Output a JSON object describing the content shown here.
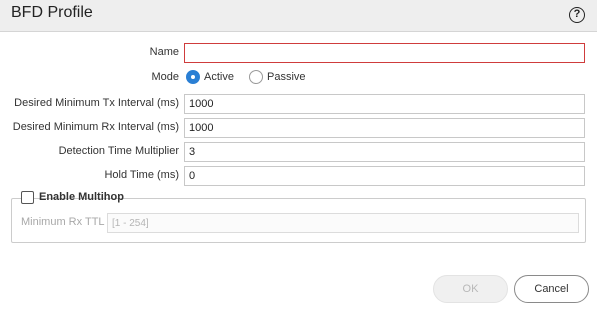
{
  "dialog": {
    "title": "BFD Profile",
    "help_symbol": "?"
  },
  "form": {
    "name": {
      "label": "Name",
      "value": "",
      "required": true
    },
    "mode": {
      "label": "Mode",
      "options": [
        {
          "label": "Active",
          "checked": true
        },
        {
          "label": "Passive",
          "checked": false
        }
      ]
    },
    "tx_interval": {
      "label": "Desired Minimum Tx Interval (ms)",
      "value": "1000"
    },
    "rx_interval": {
      "label": "Desired Minimum Rx Interval (ms)",
      "value": "1000"
    },
    "detection_multiplier": {
      "label": "Detection Time Multiplier",
      "value": "3"
    },
    "hold_time": {
      "label": "Hold Time (ms)",
      "value": "0"
    }
  },
  "multihop": {
    "label": "Enable Multihop",
    "checked": false,
    "min_rx_ttl": {
      "label": "Minimum Rx TTL",
      "placeholder": "[1 - 254]",
      "disabled": true
    }
  },
  "footer": {
    "ok_label": "OK",
    "cancel_label": "Cancel"
  },
  "colors": {
    "accent": "#2a7fd4",
    "required_border": "#cf3c3c",
    "titlebar_bg": "#eeeeee"
  }
}
